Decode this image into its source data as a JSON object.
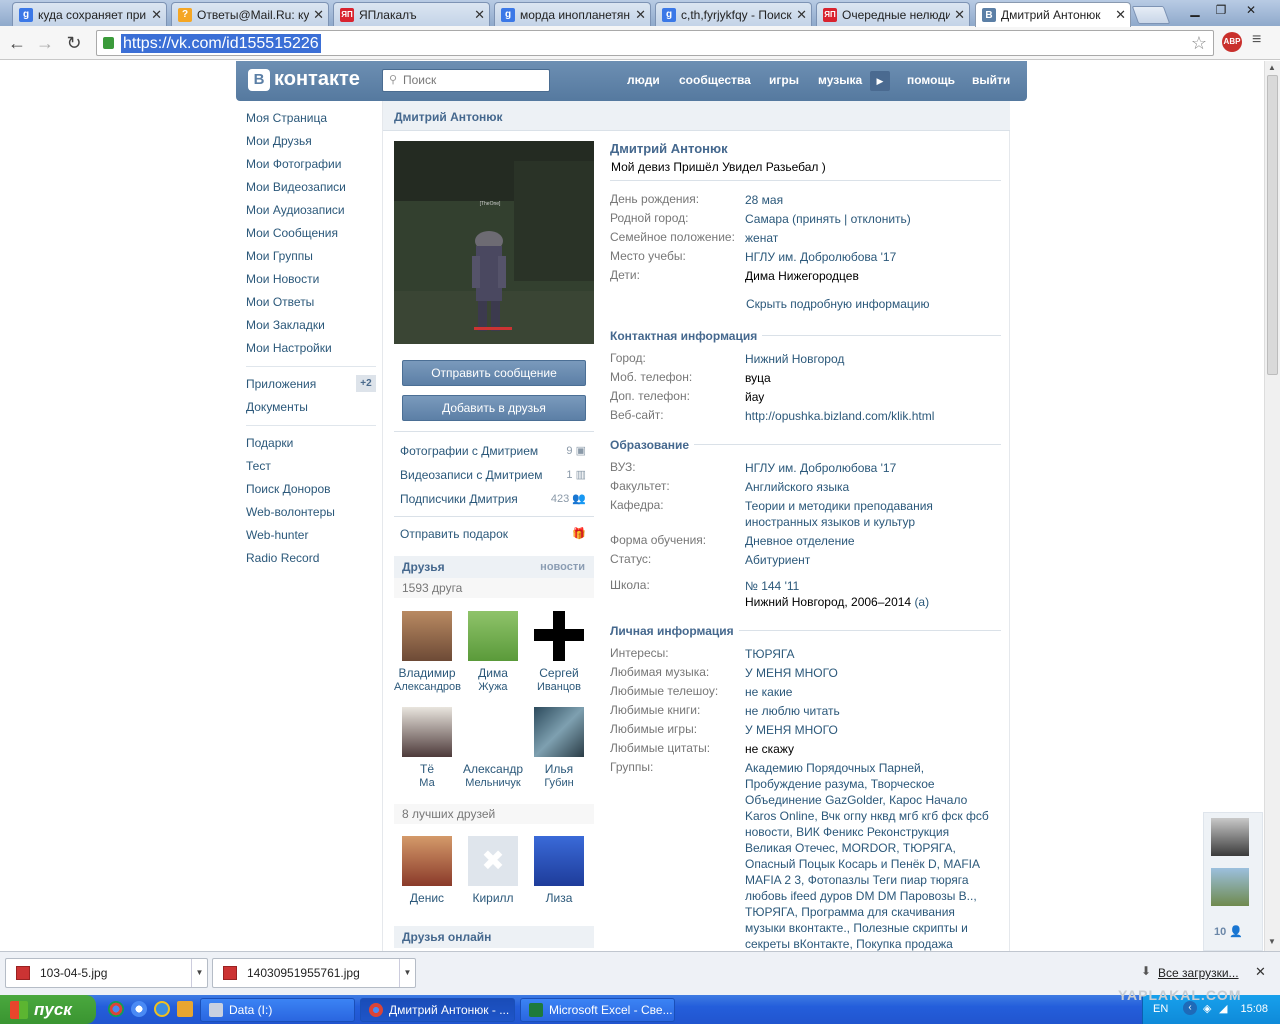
{
  "browser": {
    "tabs": [
      {
        "title": "куда сохраняет при",
        "icon": "google-icon",
        "color": "#3b78e7",
        "letter": "g"
      },
      {
        "title": "Ответы@Mail.Ru: ку",
        "icon": "mailru-answers-icon",
        "color": "#f5a623",
        "letter": "?"
      },
      {
        "title": "ЯПлакалъ",
        "icon": "yaplakal-icon",
        "color": "#d9232f",
        "letter": "ЯП"
      },
      {
        "title": "морда инопланетян",
        "icon": "google-icon",
        "color": "#3b78e7",
        "letter": "g"
      },
      {
        "title": "c,th,fyrjykfqy - Поиск",
        "icon": "google-icon",
        "color": "#3b78e7",
        "letter": "g"
      },
      {
        "title": "Очередные нелюди",
        "icon": "yaplakal-icon",
        "color": "#d9232f",
        "letter": "ЯП"
      },
      {
        "title": "Дмитрий Антонюк",
        "icon": "vk-icon",
        "color": "#5b7fa6",
        "letter": "B"
      }
    ],
    "close_glyph": "✕",
    "url": "https://vk.com/id155515226",
    "abp": "ABP"
  },
  "vk": {
    "logo": "контакте",
    "logo_letter": "B",
    "search_placeholder": "Поиск",
    "nav": [
      "люди",
      "сообщества",
      "игры",
      "музыка",
      "помощь",
      "выйти"
    ]
  },
  "menu": {
    "items": [
      "Моя Страница",
      "Мои Друзья",
      "Мои Фотографии",
      "Мои Видеозаписи",
      "Мои Аудиозаписи",
      "Мои Сообщения",
      "Мои Группы",
      "Мои Новости",
      "Мои Ответы",
      "Мои Закладки",
      "Мои Настройки"
    ],
    "apps": "Приложения",
    "apps_badge": "+2",
    "docs": "Документы",
    "extra": [
      "Подарки",
      "Тест",
      "Поиск Доноров",
      "Web-волонтеры",
      "Web-hunter",
      "Radio Record"
    ]
  },
  "profile": {
    "header_title": "Дмитрий Антонюк",
    "avatar_caption": "[TheOne]",
    "send_message": "Отправить сообщение",
    "add_friend": "Добавить в друзья",
    "links": [
      {
        "label": "Фотографии с Дмитрием",
        "count": "9"
      },
      {
        "label": "Видеозаписи с Дмитрием",
        "count": "1"
      },
      {
        "label": "Подписчики Дмитрия",
        "count": "423"
      }
    ],
    "gift": "Отправить подарок",
    "friends_title": "Друзья",
    "friends_news": "новости",
    "friends_count": "1593 друга",
    "friends": [
      {
        "first": "Владимир",
        "last": "Александров"
      },
      {
        "first": "Дима",
        "last": "Жужа"
      },
      {
        "first": "Сергей",
        "last": "Иванцов"
      },
      {
        "first": "Тё",
        "last": "Ма"
      },
      {
        "first": "Александр",
        "last": "Мельничук"
      },
      {
        "first": "Илья",
        "last": "Губин"
      }
    ],
    "best_title": "8 лучших друзей",
    "best": [
      "Денис",
      "Кирилл",
      "Лиза"
    ],
    "online_title": "Друзья онлайн"
  },
  "info": {
    "name": "Дмитрий Антонюк",
    "motto": "Мой девиз Пришёл Увидел Разьебал )",
    "main": [
      {
        "label": "День рождения:",
        "value": "28 мая"
      },
      {
        "label": "Родной город:",
        "value": "Самара (принять | отклонить)"
      },
      {
        "label": "Семейное положение:",
        "value": "женат"
      },
      {
        "label": "Место учебы:",
        "value": "НГЛУ им. Добролюбова '17"
      },
      {
        "label": "Дети:",
        "value": "Дима Нижегородцев"
      }
    ],
    "hide_link": "Скрыть подробную информацию",
    "contact_title": "Контактная информация",
    "contact": [
      {
        "label": "Город:",
        "value": "Нижний Новгород"
      },
      {
        "label": "Моб. телефон:",
        "value": "вуца"
      },
      {
        "label": "Доп. телефон:",
        "value": "йау"
      },
      {
        "label": "Веб-сайт:",
        "value": "http://opushka.bizland.com/klik.html"
      }
    ],
    "edu_title": "Образование",
    "edu": [
      {
        "label": "ВУЗ:",
        "value": "НГЛУ им. Добролюбова '17"
      },
      {
        "label": "Факультет:",
        "value": "Английского языка"
      },
      {
        "label": "Кафедра:",
        "value": "Теории и методики преподавания иностранных языков и культур"
      },
      {
        "label": "Форма обучения:",
        "value": "Дневное отделение"
      },
      {
        "label": "Статус:",
        "value": "Абитуриент"
      }
    ],
    "school_label": "Школа:",
    "school_value": "№ 144 '11",
    "school_years": "Нижний Новгород, 2006–2014",
    "school_a": "(а)",
    "personal_title": "Личная информация",
    "personal": [
      {
        "label": "Интересы:",
        "value": "ТЮРЯГА"
      },
      {
        "label": "Любимая музыка:",
        "value": "У МЕНЯ МНОГО"
      },
      {
        "label": "Любимые телешоу:",
        "value": "не какие"
      },
      {
        "label": "Любимые книги:",
        "value": "не люблю читать"
      },
      {
        "label": "Любимые игры:",
        "value": "У МЕНЯ МНОГО"
      },
      {
        "label": "Любимые цитаты:",
        "value": "не скажу"
      }
    ],
    "groups_label": "Группы:",
    "groups": "Академию Порядочных Парней, Пробуждение разума, Творческое Объединение GazGolder, Карос Начало Karos Online, Вчк огпу нквд мгб кгб фск фсб новости, ВИК Феникс Реконструкция Великая Отечес, MORDOR, ТЮРЯГА, Опасный Поцык Косарь и Пенёк D, MAFIA MAFIA 2 3, Фотопазлы Теги пиар тюряга любовь ifeed дуров DM DM Паровозы В.., ТЮРЯГА, Программа для скачивания музыки вконтакте., Полезные скрипты и секреты вКонтакте, Покупка продажа"
  },
  "side_count": "10",
  "downloads": {
    "files": [
      "103-04-5.jpg",
      "14030951955761.jpg"
    ],
    "all": "Все загрузки..."
  },
  "taskbar": {
    "start": "пуск",
    "tasks": [
      "Data (I:)",
      "Дмитрий Антонюк - ...",
      "Microsoft Excel - Све..."
    ],
    "lang": "EN",
    "time": "15:08"
  },
  "watermark": "YAPLAKAL.COM"
}
